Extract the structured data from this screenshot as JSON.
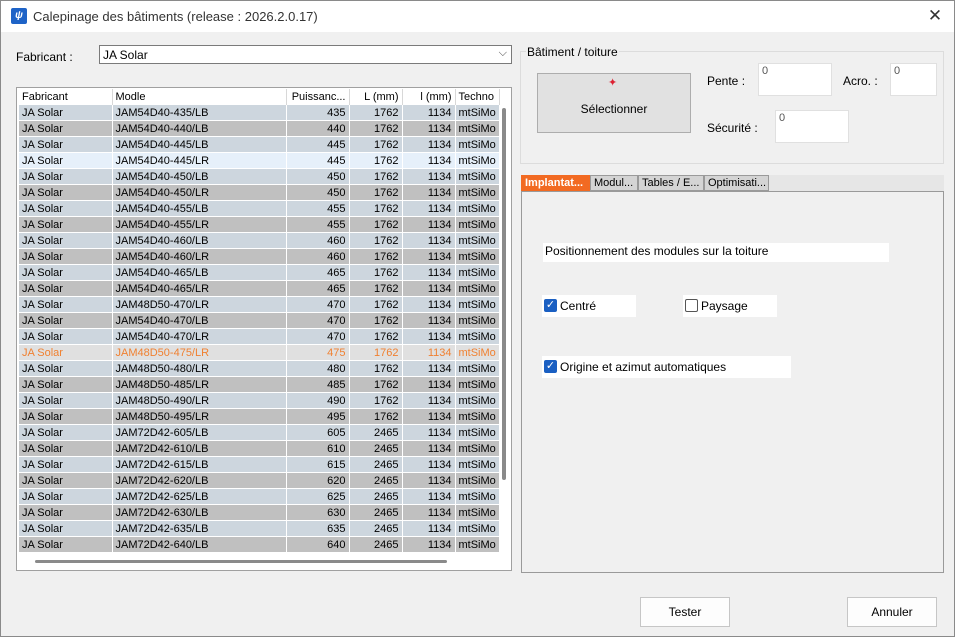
{
  "window": {
    "title": "Calepinage des bâtiments (release : 2026.2.0.17)",
    "app_icon": "app-logo-icon",
    "close_glyph": "✕"
  },
  "fabricant": {
    "label": "Fabricant :",
    "value": "JA Solar",
    "arrow": "⌵"
  },
  "table": {
    "columns": [
      "Fabricant",
      "Modle",
      "Puissanc...",
      "L (mm)",
      "l (mm)",
      "Techno"
    ],
    "rows": [
      [
        "JA Solar",
        "JAM54D40-435/LB",
        "435",
        "1762",
        "1134",
        "mtSiMo"
      ],
      [
        "JA Solar",
        "JAM54D40-440/LB",
        "440",
        "1762",
        "1134",
        "mtSiMo"
      ],
      [
        "JA Solar",
        "JAM54D40-445/LB",
        "445",
        "1762",
        "1134",
        "mtSiMo"
      ],
      [
        "JA Solar",
        "JAM54D40-445/LR",
        "445",
        "1762",
        "1134",
        "mtSiMo"
      ],
      [
        "JA Solar",
        "JAM54D40-450/LB",
        "450",
        "1762",
        "1134",
        "mtSiMo"
      ],
      [
        "JA Solar",
        "JAM54D40-450/LR",
        "450",
        "1762",
        "1134",
        "mtSiMo"
      ],
      [
        "JA Solar",
        "JAM54D40-455/LB",
        "455",
        "1762",
        "1134",
        "mtSiMo"
      ],
      [
        "JA Solar",
        "JAM54D40-455/LR",
        "455",
        "1762",
        "1134",
        "mtSiMo"
      ],
      [
        "JA Solar",
        "JAM54D40-460/LB",
        "460",
        "1762",
        "1134",
        "mtSiMo"
      ],
      [
        "JA Solar",
        "JAM54D40-460/LR",
        "460",
        "1762",
        "1134",
        "mtSiMo"
      ],
      [
        "JA Solar",
        "JAM54D40-465/LB",
        "465",
        "1762",
        "1134",
        "mtSiMo"
      ],
      [
        "JA Solar",
        "JAM54D40-465/LR",
        "465",
        "1762",
        "1134",
        "mtSiMo"
      ],
      [
        "JA Solar",
        "JAM48D50-470/LR",
        "470",
        "1762",
        "1134",
        "mtSiMo"
      ],
      [
        "JA Solar",
        "JAM54D40-470/LB",
        "470",
        "1762",
        "1134",
        "mtSiMo"
      ],
      [
        "JA Solar",
        "JAM54D40-470/LR",
        "470",
        "1762",
        "1134",
        "mtSiMo"
      ],
      [
        "JA Solar",
        "JAM48D50-475/LR",
        "475",
        "1762",
        "1134",
        "mtSiMo"
      ],
      [
        "JA Solar",
        "JAM48D50-480/LR",
        "480",
        "1762",
        "1134",
        "mtSiMo"
      ],
      [
        "JA Solar",
        "JAM48D50-485/LR",
        "485",
        "1762",
        "1134",
        "mtSiMo"
      ],
      [
        "JA Solar",
        "JAM48D50-490/LR",
        "490",
        "1762",
        "1134",
        "mtSiMo"
      ],
      [
        "JA Solar",
        "JAM48D50-495/LR",
        "495",
        "1762",
        "1134",
        "mtSiMo"
      ],
      [
        "JA Solar",
        "JAM72D42-605/LB",
        "605",
        "2465",
        "1134",
        "mtSiMo"
      ],
      [
        "JA Solar",
        "JAM72D42-610/LB",
        "610",
        "2465",
        "1134",
        "mtSiMo"
      ],
      [
        "JA Solar",
        "JAM72D42-615/LB",
        "615",
        "2465",
        "1134",
        "mtSiMo"
      ],
      [
        "JA Solar",
        "JAM72D42-620/LB",
        "620",
        "2465",
        "1134",
        "mtSiMo"
      ],
      [
        "JA Solar",
        "JAM72D42-625/LB",
        "625",
        "2465",
        "1134",
        "mtSiMo"
      ],
      [
        "JA Solar",
        "JAM72D42-630/LB",
        "630",
        "2465",
        "1134",
        "mtSiMo"
      ],
      [
        "JA Solar",
        "JAM72D42-635/LB",
        "635",
        "2465",
        "1134",
        "mtSiMo"
      ],
      [
        "JA Solar",
        "JAM72D42-640/LB",
        "640",
        "2465",
        "1134",
        "mtSiMo"
      ]
    ],
    "row_styles": [
      "odd",
      "even",
      "odd",
      "hl",
      "odd",
      "even",
      "odd",
      "even",
      "odd",
      "even",
      "odd",
      "even",
      "odd",
      "even",
      "odd",
      "orange",
      "odd",
      "even",
      "odd",
      "even",
      "odd",
      "even",
      "odd",
      "even",
      "odd",
      "even",
      "odd",
      "even"
    ]
  },
  "batiment": {
    "group_title": "Bâtiment / toiture",
    "select_button": "Sélectionner",
    "select_icon": "roof-pick-icon",
    "pente_label": "Pente :",
    "pente_value": "0",
    "acro_label": "Acro. :",
    "acro_value": "0",
    "securite_label": "Sécurité :",
    "securite_value": "0"
  },
  "tabs": [
    "Implantat...",
    "Modul...",
    "Tables / E...",
    "Optimisati..."
  ],
  "implantation": {
    "info": "Positionnement des modules sur la toiture",
    "centre_label": "Centré",
    "centre_checked": true,
    "paysage_label": "Paysage",
    "paysage_checked": false,
    "origine_label": "Origine et azimut automatiques",
    "origine_checked": true,
    "check_glyph": "✓"
  },
  "buttons": {
    "tester": "Tester",
    "annuler": "Annuler"
  },
  "colors": {
    "accent_tab": "#f26a22",
    "checkbox": "#1a5fc2",
    "row_odd": "#cdd6de",
    "row_even": "#c0c0c0",
    "row_highlight": "#e6f0fa",
    "row_orange_text": "#f08030"
  }
}
